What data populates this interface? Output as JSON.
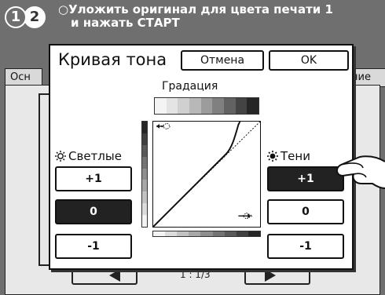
{
  "topbar": {
    "badge_1": "1",
    "badge_2": "2",
    "bullet": "○",
    "message_line1": "Уложить оригинал для цвета печати 1",
    "message_line2": "и нажать СТАРТ"
  },
  "background": {
    "tab_left": "Осн",
    "tab_right": "ние",
    "page_indicator": "1 : 1/3"
  },
  "dialog": {
    "title": "Кривая тона",
    "cancel_label": "Отмена",
    "ok_label": "OK",
    "gradation_label": "Градация",
    "highlights_label": "Светлые",
    "shadows_label": "Тени",
    "highlights_buttons": [
      "+1",
      "0",
      "-1"
    ],
    "highlights_selected": "0",
    "shadows_buttons": [
      "+1",
      "0",
      "-1"
    ],
    "shadows_selected": "+1"
  },
  "colors": {
    "background": "#6f6f6f",
    "panel": "#e8e8e8",
    "dialog": "#ffffff",
    "selected": "#222222"
  },
  "icons": {
    "highlights": "sun-outline-icon",
    "shadows": "sun-filled-icon",
    "finger": "pointing-hand-icon",
    "arrow_left": "arrow-left-icon",
    "arrow_right": "arrow-right-icon"
  }
}
